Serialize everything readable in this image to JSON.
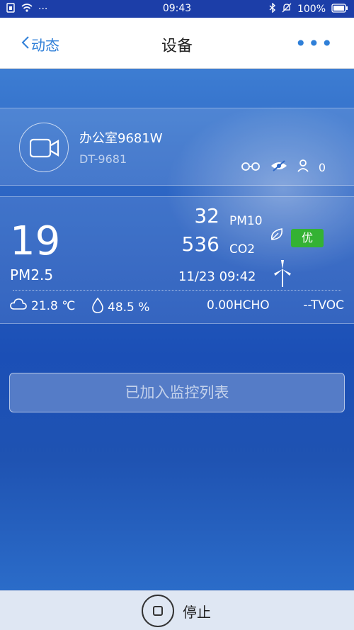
{
  "statusbar": {
    "time": "09:43",
    "battery": "100%",
    "dots": "···"
  },
  "nav": {
    "back_label": "动态",
    "title": "设备",
    "more_label": "•••"
  },
  "device": {
    "name": "办公室9681W",
    "id": "DT-9681",
    "viewer_count": "0"
  },
  "air": {
    "pm25_value": "19",
    "pm25_label": "PM2.5",
    "pm10_value": "32",
    "pm10_label": "PM10",
    "co2_value": "536",
    "co2_label": "CO2",
    "quality_badge": "优",
    "datetime": "11/23  09:42",
    "temperature": "21.8 ℃",
    "humidity": "48.5 %",
    "hcho": "0.00HCHO",
    "tvoc": "--TVOC"
  },
  "actions": {
    "monitor_label": "已加入监控列表",
    "stop_label": "停止"
  },
  "colors": {
    "accent": "#2f7fd8",
    "badge_green": "#34b233"
  }
}
